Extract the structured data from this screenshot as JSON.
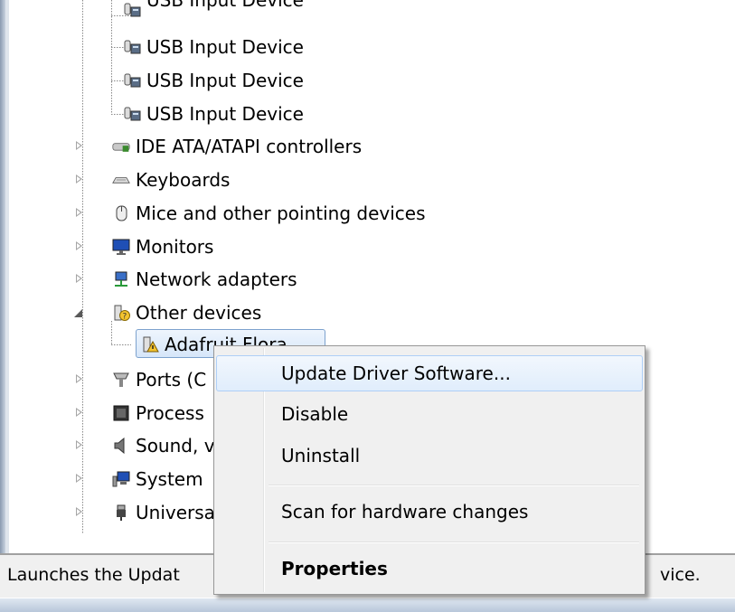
{
  "tree": {
    "usb_items": [
      {
        "label": "USB Input Device"
      },
      {
        "label": "USB Input Device"
      },
      {
        "label": "USB Input Device"
      },
      {
        "label": "USB Input Device"
      }
    ],
    "categories": {
      "ide": {
        "label": "IDE ATA/ATAPI controllers",
        "icon": "ide-controller-icon"
      },
      "keyboards": {
        "label": "Keyboards",
        "icon": "keyboard-icon"
      },
      "mice": {
        "label": "Mice and other pointing devices",
        "icon": "mouse-icon"
      },
      "monitors": {
        "label": "Monitors",
        "icon": "monitor-icon"
      },
      "network": {
        "label": "Network adapters",
        "icon": "network-adapter-icon"
      },
      "other": {
        "label": "Other devices",
        "icon": "unknown-device-icon"
      },
      "ports": {
        "label": "Ports (C",
        "icon": "port-icon"
      },
      "processors": {
        "label": "Process",
        "icon": "processor-icon"
      },
      "sound": {
        "label": "Sound, v",
        "icon": "speaker-icon"
      },
      "system": {
        "label": "System",
        "icon": "system-device-icon"
      },
      "universal": {
        "label": "Universa",
        "icon": "usb-icon"
      }
    },
    "selected_device": {
      "label": "Adafruit Flora",
      "icon": "warning-device-icon"
    }
  },
  "context_menu": {
    "update_driver": "Update Driver Software...",
    "disable": "Disable",
    "uninstall": "Uninstall",
    "scan": "Scan for hardware changes",
    "properties": "Properties"
  },
  "status_bar": {
    "text_left": "Launches the Updat",
    "text_right": "vice."
  },
  "colors": {
    "selection_border": "#7da2ce",
    "menu_hover_border": "#aecff7",
    "menu_background": "#f0f0f0"
  }
}
